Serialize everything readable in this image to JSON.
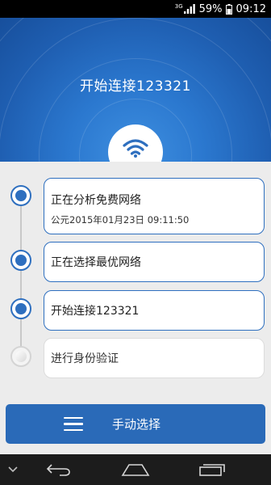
{
  "status_bar": {
    "network": "3G",
    "battery_percent": "59%",
    "time": "09:12"
  },
  "header": {
    "title": "开始连接123321"
  },
  "steps": [
    {
      "title": "正在分析免费网络",
      "time": "公元2015年01月23日 09:11:50",
      "state": "done"
    },
    {
      "title": "正在选择最优网络",
      "state": "done"
    },
    {
      "title": "开始连接123321",
      "state": "done"
    },
    {
      "title": "进行身份验证",
      "state": "pending"
    }
  ],
  "manual_button": {
    "label": "手动选择"
  },
  "icons": {
    "wifi": "wifi-icon",
    "menu": "menu-icon",
    "back": "back-icon",
    "home": "home-icon",
    "recent": "recent-apps-icon",
    "collapse": "chevron-down-icon"
  },
  "colors": {
    "primary": "#2e6fbf",
    "button": "#2a6ab8",
    "header": "#1f5fb2"
  }
}
